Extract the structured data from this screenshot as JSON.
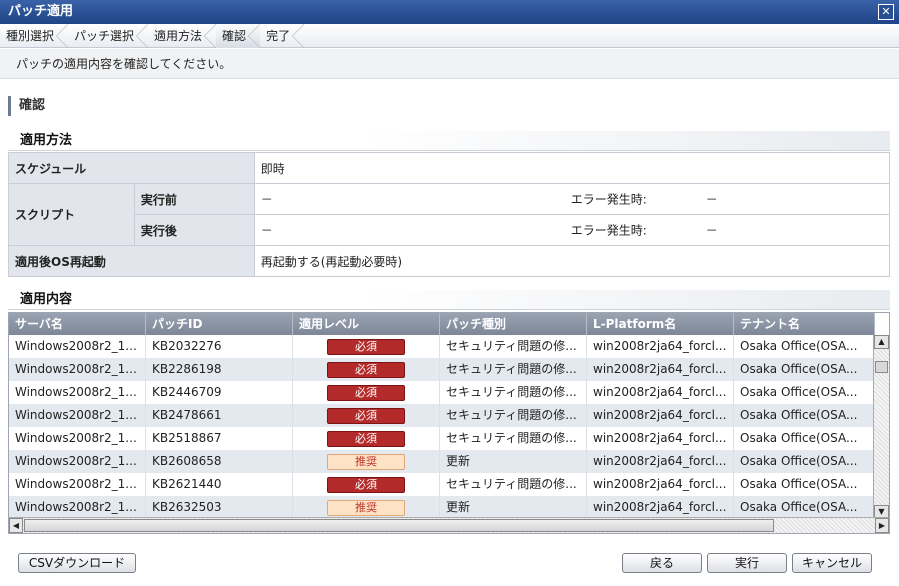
{
  "window": {
    "title": "パッチ適用",
    "close_label": "✕"
  },
  "steps": [
    {
      "label": "種別選択",
      "active": false
    },
    {
      "label": "パッチ選択",
      "active": false
    },
    {
      "label": "適用方法",
      "active": false
    },
    {
      "label": "確認",
      "active": true
    },
    {
      "label": "完了",
      "active": false
    }
  ],
  "instruction": "パッチの適用内容を確認してください。",
  "section_title": "確認",
  "method": {
    "title": "適用方法",
    "schedule_label": "スケジュール",
    "schedule_value": "即時",
    "script_label": "スクリプト",
    "before_label": "実行前",
    "before_value": "－",
    "before_error_label": "エラー発生時:",
    "before_error_value": "－",
    "after_label": "実行後",
    "after_value": "－",
    "after_error_label": "エラー発生時:",
    "after_error_value": "－",
    "reboot_label": "適用後OS再起動",
    "reboot_value": "再起動する(再起動必要時)"
  },
  "content": {
    "title": "適用内容",
    "columns": [
      "サーバ名",
      "パッチID",
      "適用レベル",
      "パッチ種別",
      "L-Platform名",
      "テナント名"
    ],
    "rows": [
      {
        "server": "Windows2008r2_1...",
        "patch_id": "KB2032276",
        "level": "必須",
        "level_type": "required",
        "kind": "セキュリティ問題の修...",
        "lplatform": "win2008r2ja64_forcl...",
        "tenant": "Osaka Office(OSA..."
      },
      {
        "server": "Windows2008r2_1...",
        "patch_id": "KB2286198",
        "level": "必須",
        "level_type": "required",
        "kind": "セキュリティ問題の修...",
        "lplatform": "win2008r2ja64_forcl...",
        "tenant": "Osaka Office(OSA..."
      },
      {
        "server": "Windows2008r2_1...",
        "patch_id": "KB2446709",
        "level": "必須",
        "level_type": "required",
        "kind": "セキュリティ問題の修...",
        "lplatform": "win2008r2ja64_forcl...",
        "tenant": "Osaka Office(OSA..."
      },
      {
        "server": "Windows2008r2_1...",
        "patch_id": "KB2478661",
        "level": "必須",
        "level_type": "required",
        "kind": "セキュリティ問題の修...",
        "lplatform": "win2008r2ja64_forcl...",
        "tenant": "Osaka Office(OSA..."
      },
      {
        "server": "Windows2008r2_1...",
        "patch_id": "KB2518867",
        "level": "必須",
        "level_type": "required",
        "kind": "セキュリティ問題の修...",
        "lplatform": "win2008r2ja64_forcl...",
        "tenant": "Osaka Office(OSA..."
      },
      {
        "server": "Windows2008r2_1...",
        "patch_id": "KB2608658",
        "level": "推奨",
        "level_type": "recommended",
        "kind": "更新",
        "lplatform": "win2008r2ja64_forcl...",
        "tenant": "Osaka Office(OSA..."
      },
      {
        "server": "Windows2008r2_1...",
        "patch_id": "KB2621440",
        "level": "必須",
        "level_type": "required",
        "kind": "セキュリティ問題の修...",
        "lplatform": "win2008r2ja64_forcl...",
        "tenant": "Osaka Office(OSA..."
      },
      {
        "server": "Windows2008r2_1...",
        "patch_id": "KB2632503",
        "level": "推奨",
        "level_type": "recommended",
        "kind": "更新",
        "lplatform": "win2008r2ja64_forcl...",
        "tenant": "Osaka Office(OSA..."
      }
    ]
  },
  "buttons": {
    "csv": "CSVダウンロード",
    "back": "戻る",
    "execute": "実行",
    "cancel": "キャンセル"
  },
  "colors": {
    "titlebar": "#1f4486",
    "required_badge": "#b32a2a",
    "recommended_badge": "#fde2c6",
    "grid_header": "#8891a1"
  }
}
